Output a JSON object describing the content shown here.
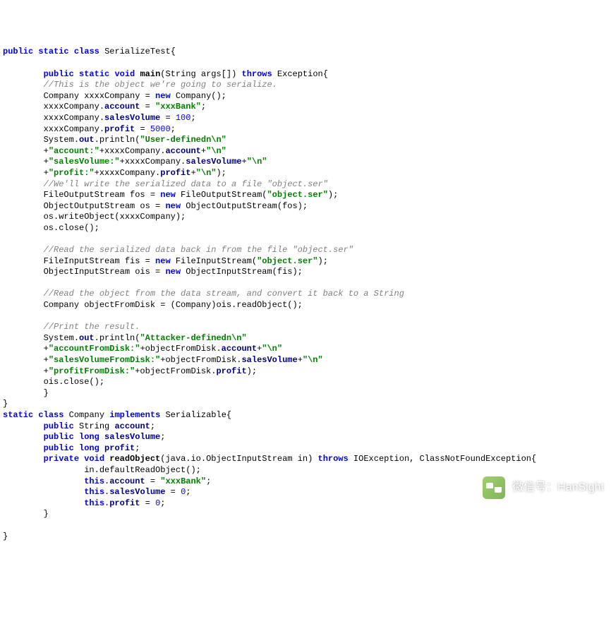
{
  "lines": [
    {
      "indent": 0,
      "parts": [
        {
          "c": "kw",
          "t": "public"
        },
        {
          "t": " "
        },
        {
          "c": "kw",
          "t": "static"
        },
        {
          "t": " "
        },
        {
          "c": "kw",
          "t": "class"
        },
        {
          "t": " "
        },
        {
          "c": "classname",
          "t": "SerializeTest"
        },
        {
          "t": "{"
        }
      ]
    },
    {
      "indent": 0,
      "parts": []
    },
    {
      "indent": 2,
      "parts": [
        {
          "c": "kw",
          "t": "public"
        },
        {
          "t": " "
        },
        {
          "c": "kw",
          "t": "static"
        },
        {
          "t": " "
        },
        {
          "c": "kw",
          "t": "void"
        },
        {
          "t": " "
        },
        {
          "c": "methoddef",
          "t": "main"
        },
        {
          "t": "(String args[]) "
        },
        {
          "c": "kw",
          "t": "throws"
        },
        {
          "t": " Exception{"
        }
      ]
    },
    {
      "indent": 2,
      "parts": [
        {
          "c": "comment",
          "t": "//This is the object we're going to serialize."
        }
      ]
    },
    {
      "indent": 2,
      "parts": [
        {
          "t": "Company xxxxCompany = "
        },
        {
          "c": "kw",
          "t": "new"
        },
        {
          "t": " Company();"
        }
      ]
    },
    {
      "indent": 2,
      "parts": [
        {
          "t": "xxxxCompany."
        },
        {
          "c": "field",
          "t": "account"
        },
        {
          "t": " = "
        },
        {
          "c": "str",
          "t": "\"xxxBank\""
        },
        {
          "t": ";"
        }
      ]
    },
    {
      "indent": 2,
      "parts": [
        {
          "t": "xxxxCompany."
        },
        {
          "c": "field",
          "t": "salesVolume"
        },
        {
          "t": " = "
        },
        {
          "c": "num",
          "t": "100"
        },
        {
          "t": ";"
        }
      ]
    },
    {
      "indent": 2,
      "parts": [
        {
          "t": "xxxxCompany."
        },
        {
          "c": "field",
          "t": "profit"
        },
        {
          "t": " = "
        },
        {
          "c": "num",
          "t": "5000"
        },
        {
          "t": ";"
        }
      ]
    },
    {
      "indent": 2,
      "parts": [
        {
          "t": "System."
        },
        {
          "c": "field",
          "t": "out"
        },
        {
          "t": ".println("
        },
        {
          "c": "str",
          "t": "\"User-definedn\\n\""
        }
      ]
    },
    {
      "indent": 2,
      "parts": [
        {
          "t": "+"
        },
        {
          "c": "str",
          "t": "\"account:\""
        },
        {
          "t": "+xxxxCompany."
        },
        {
          "c": "field",
          "t": "account"
        },
        {
          "t": "+"
        },
        {
          "c": "str",
          "t": "\"\\n\""
        }
      ]
    },
    {
      "indent": 2,
      "parts": [
        {
          "t": "+"
        },
        {
          "c": "str",
          "t": "\"salesVolume:\""
        },
        {
          "t": "+xxxxCompany."
        },
        {
          "c": "field",
          "t": "salesVolume"
        },
        {
          "t": "+"
        },
        {
          "c": "str",
          "t": "\"\\n\""
        }
      ]
    },
    {
      "indent": 2,
      "parts": [
        {
          "t": "+"
        },
        {
          "c": "str",
          "t": "\"profit:\""
        },
        {
          "t": "+xxxxCompany."
        },
        {
          "c": "field",
          "t": "profit"
        },
        {
          "t": "+"
        },
        {
          "c": "str",
          "t": "\"\\n\""
        },
        {
          "t": ");"
        }
      ]
    },
    {
      "indent": 2,
      "parts": [
        {
          "c": "comment",
          "t": "//We'll write the serialized data to a file \"object.ser\""
        }
      ]
    },
    {
      "indent": 2,
      "parts": [
        {
          "t": "FileOutputStream fos = "
        },
        {
          "c": "kw",
          "t": "new"
        },
        {
          "t": " FileOutputStream("
        },
        {
          "c": "str",
          "t": "\"object.ser\""
        },
        {
          "t": ");"
        }
      ]
    },
    {
      "indent": 2,
      "parts": [
        {
          "t": "ObjectOutputStream os = "
        },
        {
          "c": "kw",
          "t": "new"
        },
        {
          "t": " ObjectOutputStream(fos);"
        }
      ]
    },
    {
      "indent": 2,
      "parts": [
        {
          "t": "os.writeObject(xxxxCompany);"
        }
      ]
    },
    {
      "indent": 2,
      "parts": [
        {
          "t": "os.close();"
        }
      ]
    },
    {
      "indent": 0,
      "parts": []
    },
    {
      "indent": 2,
      "parts": [
        {
          "c": "comment",
          "t": "//Read the serialized data back in from the file \"object.ser\""
        }
      ]
    },
    {
      "indent": 2,
      "parts": [
        {
          "t": "FileInputStream fis = "
        },
        {
          "c": "kw",
          "t": "new"
        },
        {
          "t": " FileInputStream("
        },
        {
          "c": "str",
          "t": "\"object.ser\""
        },
        {
          "t": ");"
        }
      ]
    },
    {
      "indent": 2,
      "parts": [
        {
          "t": "ObjectInputStream ois = "
        },
        {
          "c": "kw",
          "t": "new"
        },
        {
          "t": " ObjectInputStream(fis);"
        }
      ]
    },
    {
      "indent": 0,
      "parts": []
    },
    {
      "indent": 2,
      "parts": [
        {
          "c": "comment",
          "t": "//Read the object from the data stream, and convert it back to a String"
        }
      ]
    },
    {
      "indent": 2,
      "parts": [
        {
          "t": "Company objectFromDisk = (Company)ois.readObject();"
        }
      ]
    },
    {
      "indent": 0,
      "parts": []
    },
    {
      "indent": 2,
      "parts": [
        {
          "c": "comment",
          "t": "//Print the result."
        }
      ]
    },
    {
      "indent": 2,
      "parts": [
        {
          "t": "System."
        },
        {
          "c": "field",
          "t": "out"
        },
        {
          "t": ".println("
        },
        {
          "c": "str",
          "t": "\"Attacker-definedn\\n\""
        }
      ]
    },
    {
      "indent": 2,
      "parts": [
        {
          "t": "+"
        },
        {
          "c": "str",
          "t": "\"accountFromDisk:\""
        },
        {
          "t": "+objectFromDisk."
        },
        {
          "c": "field",
          "t": "account"
        },
        {
          "t": "+"
        },
        {
          "c": "str",
          "t": "\"\\n\""
        }
      ]
    },
    {
      "indent": 2,
      "parts": [
        {
          "t": "+"
        },
        {
          "c": "str",
          "t": "\"salesVolumeFromDisk:\""
        },
        {
          "t": "+objectFromDisk."
        },
        {
          "c": "field",
          "t": "salesVolume"
        },
        {
          "t": "+"
        },
        {
          "c": "str",
          "t": "\"\\n\""
        }
      ]
    },
    {
      "indent": 2,
      "parts": [
        {
          "t": "+"
        },
        {
          "c": "str",
          "t": "\"profitFromDisk:\""
        },
        {
          "t": "+objectFromDisk."
        },
        {
          "c": "field",
          "t": "profit"
        },
        {
          "t": ");"
        }
      ]
    },
    {
      "indent": 2,
      "parts": [
        {
          "t": "ois.close();"
        }
      ]
    },
    {
      "indent": 2,
      "parts": [
        {
          "t": "}"
        }
      ]
    },
    {
      "indent": 0,
      "parts": [
        {
          "t": "}"
        }
      ]
    },
    {
      "indent": 0,
      "parts": [
        {
          "c": "kw",
          "t": "static"
        },
        {
          "t": " "
        },
        {
          "c": "kw",
          "t": "class"
        },
        {
          "t": " "
        },
        {
          "c": "classname",
          "t": "Company"
        },
        {
          "t": " "
        },
        {
          "c": "kw",
          "t": "implements"
        },
        {
          "t": " Serializable{"
        }
      ]
    },
    {
      "indent": 2,
      "parts": [
        {
          "c": "kw",
          "t": "public"
        },
        {
          "t": " String "
        },
        {
          "c": "field",
          "t": "account"
        },
        {
          "t": ";"
        }
      ]
    },
    {
      "indent": 2,
      "parts": [
        {
          "c": "kw",
          "t": "public"
        },
        {
          "t": " "
        },
        {
          "c": "kw",
          "t": "long"
        },
        {
          "t": " "
        },
        {
          "c": "field",
          "t": "salesVolume"
        },
        {
          "t": ";"
        }
      ]
    },
    {
      "indent": 2,
      "parts": [
        {
          "c": "kw",
          "t": "public"
        },
        {
          "t": " "
        },
        {
          "c": "kw",
          "t": "long"
        },
        {
          "t": " "
        },
        {
          "c": "field",
          "t": "profit"
        },
        {
          "t": ";"
        }
      ]
    },
    {
      "indent": 2,
      "parts": [
        {
          "c": "kw",
          "t": "private"
        },
        {
          "t": " "
        },
        {
          "c": "kw",
          "t": "void"
        },
        {
          "t": " "
        },
        {
          "c": "methoddef",
          "t": "readObject"
        },
        {
          "t": "(java.io.ObjectInputStream in) "
        },
        {
          "c": "kw",
          "t": "throws"
        },
        {
          "t": " IOException, ClassNotFoundException{"
        }
      ]
    },
    {
      "indent": 4,
      "parts": [
        {
          "t": "in.defaultReadObject();"
        }
      ]
    },
    {
      "indent": 4,
      "parts": [
        {
          "c": "kw",
          "t": "this"
        },
        {
          "t": "."
        },
        {
          "c": "field",
          "t": "account"
        },
        {
          "t": " = "
        },
        {
          "c": "str",
          "t": "\"xxxBank\""
        },
        {
          "t": ";"
        }
      ]
    },
    {
      "indent": 4,
      "parts": [
        {
          "c": "kw",
          "t": "this"
        },
        {
          "t": "."
        },
        {
          "c": "field",
          "t": "salesVolume"
        },
        {
          "t": " = "
        },
        {
          "c": "num",
          "t": "0"
        },
        {
          "t": ";"
        }
      ]
    },
    {
      "indent": 4,
      "parts": [
        {
          "c": "kw",
          "t": "this"
        },
        {
          "t": "."
        },
        {
          "c": "field",
          "t": "profit"
        },
        {
          "t": " = "
        },
        {
          "c": "num",
          "t": "0"
        },
        {
          "t": ";"
        }
      ]
    },
    {
      "indent": 2,
      "parts": [
        {
          "t": "}"
        }
      ]
    },
    {
      "indent": 0,
      "parts": []
    },
    {
      "indent": 0,
      "parts": [
        {
          "t": "}"
        }
      ]
    }
  ],
  "watermark": {
    "label": "微信号：HanSight"
  }
}
